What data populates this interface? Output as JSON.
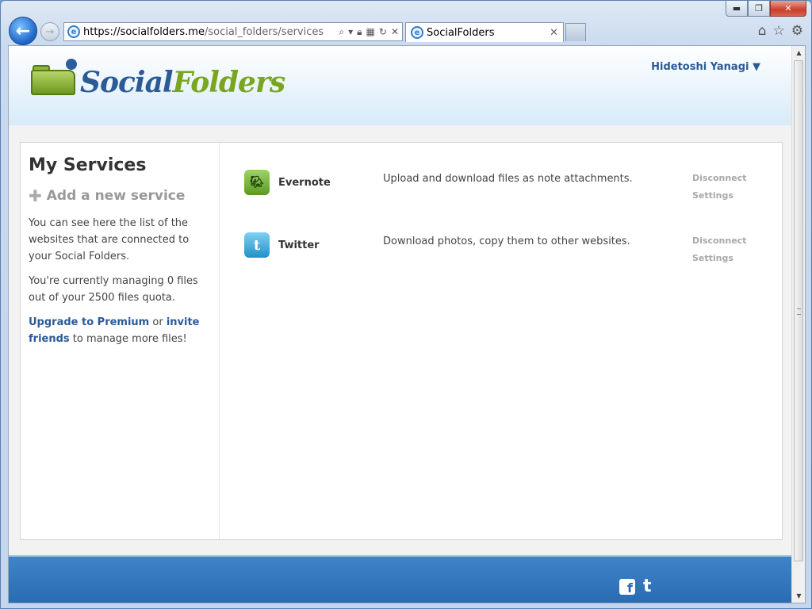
{
  "browser": {
    "url_host": "https://socialfolders.me",
    "url_path": "/social_folders/services",
    "tab_title": "SocialFolders",
    "caption": {
      "minimize": "▬",
      "maximize": "❐",
      "close": "✕"
    }
  },
  "header": {
    "logo_part1": "Social",
    "logo_part2": "Folders",
    "user_name": "Hidetoshi Yanagi ▼"
  },
  "sidebar": {
    "title": "My Services",
    "add_service": "Add a new service",
    "desc1": "You can see here the list of the websites that are connected to your Social Folders.",
    "desc2": "You're currently managing 0 files out of your 2500 files quota.",
    "upgrade_link": "Upgrade to Premium",
    "or_text": " or ",
    "invite_link": "invite friends",
    "manage_text": " to manage more files!"
  },
  "services": [
    {
      "name": "Evernote",
      "description": "Upload and download files as note attachments.",
      "disconnect": "Disconnect",
      "settings": "Settings",
      "color": "#6fae2e"
    },
    {
      "name": "Twitter",
      "description": "Download photos, copy them to other websites.",
      "disconnect": "Disconnect",
      "settings": "Settings",
      "color": "#2aa0d6"
    }
  ],
  "colors": {
    "brand_blue": "#2b5a96",
    "brand_green": "#7aa51e",
    "footer_blue": "#2a6bb2"
  }
}
